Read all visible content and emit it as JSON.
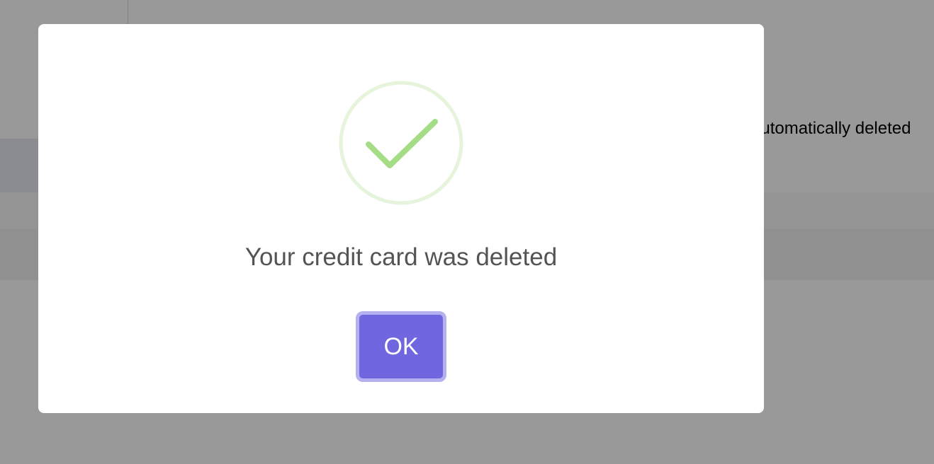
{
  "background": {
    "partial_text": "automatically deleted"
  },
  "dialog": {
    "icon": "success-check-icon",
    "message": "Your credit card was deleted",
    "confirm_label": "OK"
  },
  "colors": {
    "confirm_button": "#7066e0",
    "confirm_button_focus_ring": "#b5b0ee",
    "success_icon": "#a5dc86",
    "success_ring": "#e6f4dc",
    "message_text": "#545454",
    "overlay": "rgba(0,0,0,0.4)"
  }
}
